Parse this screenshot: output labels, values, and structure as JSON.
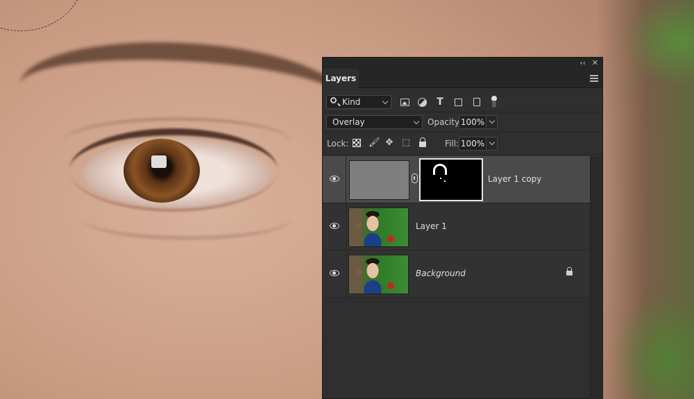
{
  "panel": {
    "collapse_glyph": "‹‹",
    "close_glyph": "✕",
    "tab_label": "Layers"
  },
  "filter": {
    "kind_label": "Kind",
    "icons": [
      "image-icon",
      "adjustment-icon",
      "type-icon",
      "shape-icon",
      "smart-object-icon",
      "filter-toggle-icon"
    ]
  },
  "blend": {
    "mode": "Overlay",
    "opacity_label": "Opacity:",
    "opacity_value": "100%"
  },
  "lock": {
    "label": "Lock:",
    "fill_label": "Fill:",
    "fill_value": "100%",
    "icons": [
      "lock-transparent-pixels-icon",
      "brush-icon",
      "move-icon",
      "artboard-icon",
      "padlock-icon"
    ]
  },
  "layers": [
    {
      "name": "Layer 1 copy",
      "selected": true,
      "has_mask": true,
      "visible": true
    },
    {
      "name": "Layer 1",
      "selected": false,
      "has_mask": false,
      "visible": true
    },
    {
      "name": "Background",
      "selected": false,
      "has_mask": false,
      "visible": true,
      "locked": true
    }
  ],
  "icon_glyphs": {
    "type": "T",
    "brush": "🖌",
    "move": "✥",
    "artboard": "⬚"
  }
}
